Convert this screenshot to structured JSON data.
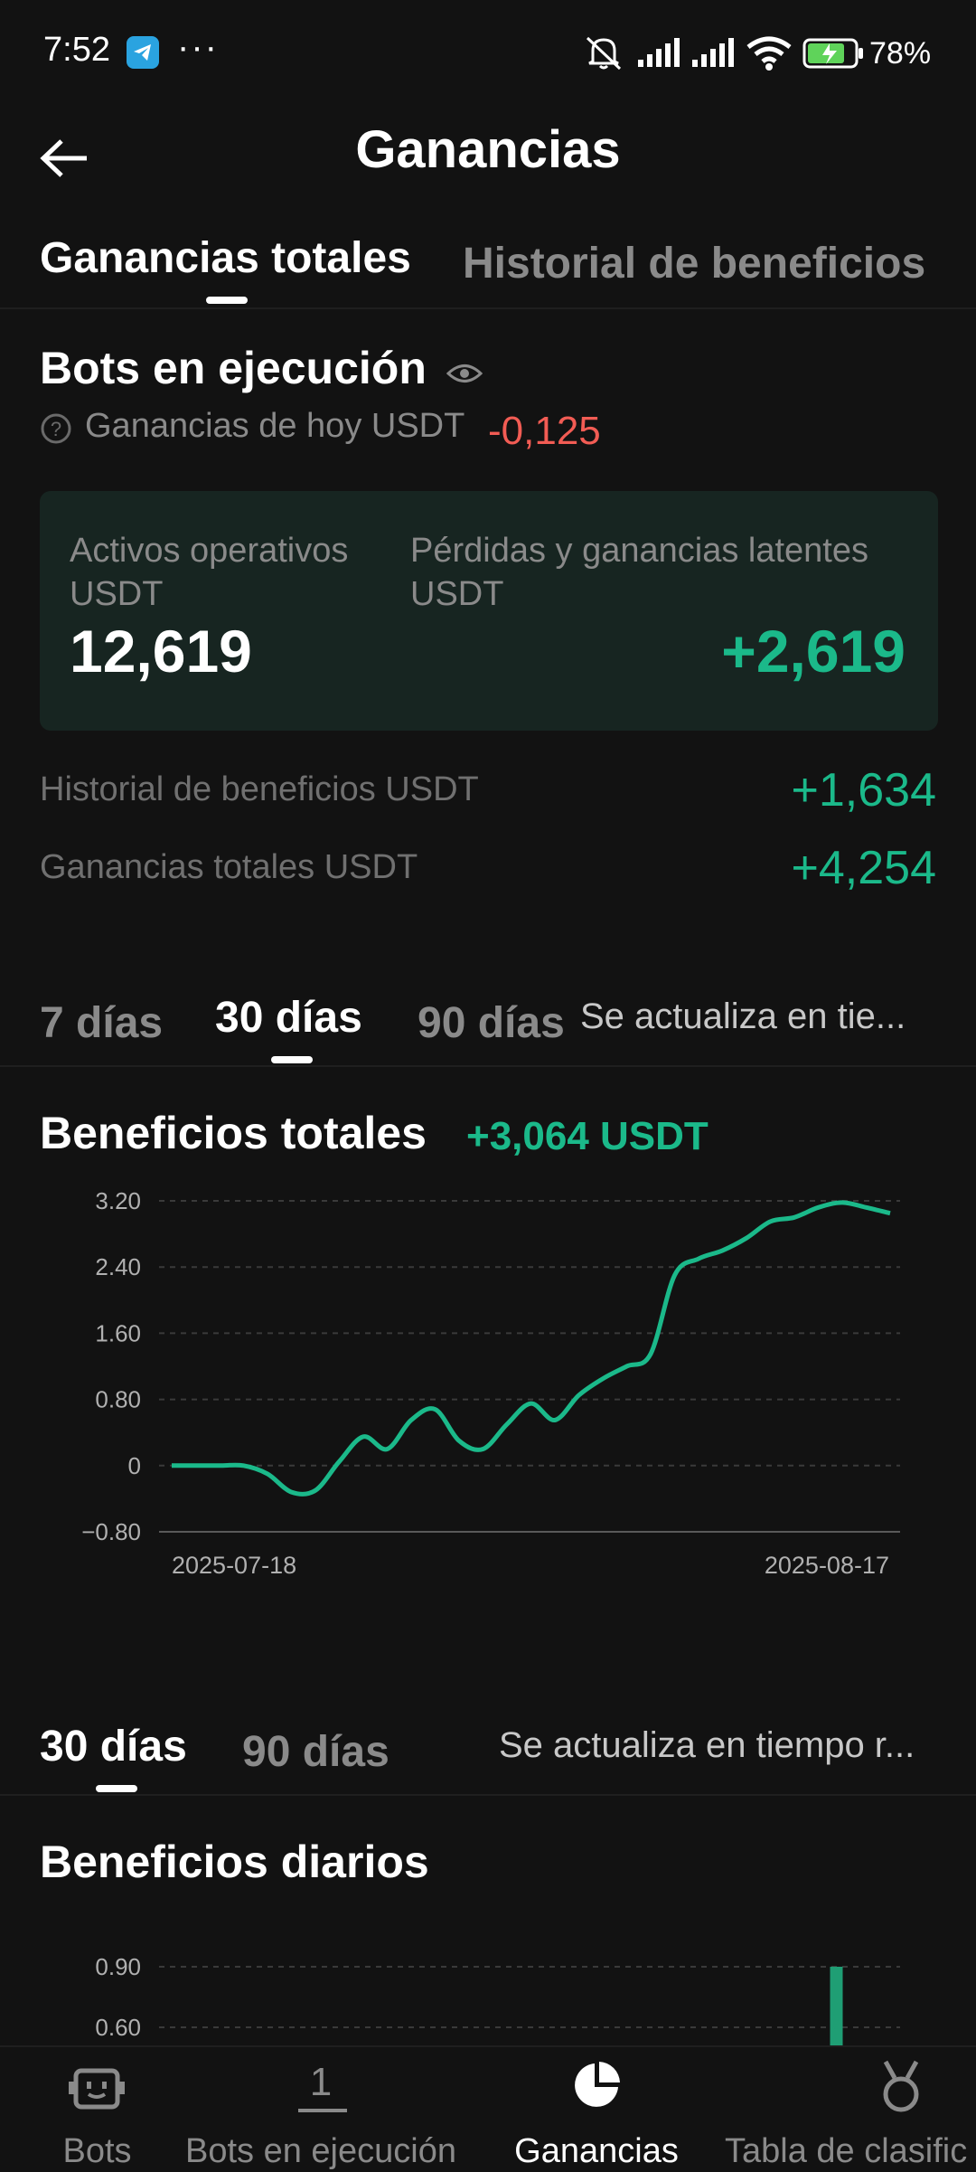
{
  "status_bar": {
    "time": "7:52",
    "dots": "···",
    "battery": "78%"
  },
  "header": {
    "title": "Ganancias"
  },
  "tabs": {
    "items": [
      {
        "label": "Ganancias totales",
        "active": true
      },
      {
        "label": "Historial de beneficios",
        "active": false
      }
    ]
  },
  "running": {
    "title": "Bots en ejecución",
    "today_label": "Ganancias de hoy USDT",
    "today_value": "-0,125",
    "assets_label_line1": "Activos operativos",
    "assets_label_line2": "USDT",
    "assets_value": "12,619",
    "latent_label_line1": "Pérdidas y ganancias latentes",
    "latent_label_line2": "USDT",
    "latent_value": "+2,619",
    "history_label": "Historial de beneficios USDT",
    "history_value": "+1,634",
    "total_label": "Ganancias totales USDT",
    "total_value": "+4,254"
  },
  "period_tabs_1": {
    "items": [
      {
        "label": "7 días",
        "active": false
      },
      {
        "label": "30 días",
        "active": true
      },
      {
        "label": "90 días",
        "active": false
      }
    ],
    "note": "Se actualiza en tie..."
  },
  "total_profit": {
    "title": "Beneficios totales",
    "value": "+3,064 USDT"
  },
  "period_tabs_2": {
    "items": [
      {
        "label": "30 días",
        "active": true
      },
      {
        "label": "90 días",
        "active": false
      }
    ],
    "note": "Se actualiza en tiempo r..."
  },
  "daily_profit": {
    "title": "Beneficios diarios"
  },
  "bottom_nav": {
    "items": [
      {
        "label": "Bots",
        "icon": "robot-icon",
        "active": false
      },
      {
        "label": "Bots en ejecución",
        "icon": "count-icon",
        "badge": "1",
        "active": false
      },
      {
        "label": "Ganancias",
        "icon": "pie-chart-icon",
        "active": true
      },
      {
        "label": "Tabla de clasific",
        "icon": "medal-icon",
        "active": false
      }
    ]
  },
  "colors": {
    "accent_green": "#1bb98a",
    "loss_red": "#f25c54",
    "card_bg": "#172521",
    "background": "#121212"
  },
  "chart_data": [
    {
      "type": "line",
      "ylim": [
        -0.8,
        3.2
      ],
      "y_ticks": [
        "3.20",
        "2.40",
        "1.60",
        "0.80",
        "0",
        "−0.80"
      ],
      "x_tick_labels": [
        "2025-07-18",
        "2025-08-17"
      ],
      "x": [
        "2025-07-18",
        "2025-07-19",
        "2025-07-20",
        "2025-07-21",
        "2025-07-22",
        "2025-07-23",
        "2025-07-24",
        "2025-07-25",
        "2025-07-26",
        "2025-07-27",
        "2025-07-28",
        "2025-07-29",
        "2025-07-30",
        "2025-07-31",
        "2025-08-01",
        "2025-08-02",
        "2025-08-03",
        "2025-08-04",
        "2025-08-05",
        "2025-08-06",
        "2025-08-07",
        "2025-08-08",
        "2025-08-09",
        "2025-08-10",
        "2025-08-11",
        "2025-08-12",
        "2025-08-13",
        "2025-08-14",
        "2025-08-15",
        "2025-08-16",
        "2025-08-17"
      ],
      "series": [
        {
          "color": "#1bb98a",
          "values": [
            0,
            0,
            0,
            0,
            -0.1,
            -0.32,
            -0.3,
            0.05,
            0.35,
            0.2,
            0.55,
            0.68,
            0.3,
            0.2,
            0.5,
            0.75,
            0.55,
            0.85,
            1.05,
            1.2,
            1.35,
            2.3,
            2.5,
            2.6,
            2.75,
            2.95,
            3.0,
            3.12,
            3.18,
            3.12,
            3.05
          ]
        }
      ],
      "grid": true
    },
    {
      "type": "bar",
      "ylim": [
        0.6,
        0.9
      ],
      "y_ticks": [
        "0.90",
        "0.60"
      ],
      "x": [
        "2025-07-18",
        "2025-07-19",
        "2025-07-20",
        "2025-07-21",
        "2025-07-22",
        "2025-07-23",
        "2025-07-24",
        "2025-07-25",
        "2025-07-26",
        "2025-07-27",
        "2025-07-28",
        "2025-07-29",
        "2025-07-30",
        "2025-07-31",
        "2025-08-01",
        "2025-08-02",
        "2025-08-03",
        "2025-08-04",
        "2025-08-05",
        "2025-08-06",
        "2025-08-07",
        "2025-08-08",
        "2025-08-09",
        "2025-08-10",
        "2025-08-11",
        "2025-08-12",
        "2025-08-13",
        "2025-08-14",
        "2025-08-15",
        "2025-08-16",
        "2025-08-17"
      ],
      "series": [
        {
          "color": "#1f9e74",
          "values": [
            null,
            null,
            null,
            null,
            null,
            null,
            null,
            null,
            null,
            null,
            null,
            null,
            null,
            null,
            null,
            null,
            null,
            null,
            null,
            null,
            null,
            0.9,
            null,
            null,
            null,
            null,
            null,
            null,
            null,
            null,
            null
          ]
        }
      ],
      "grid": true
    }
  ]
}
